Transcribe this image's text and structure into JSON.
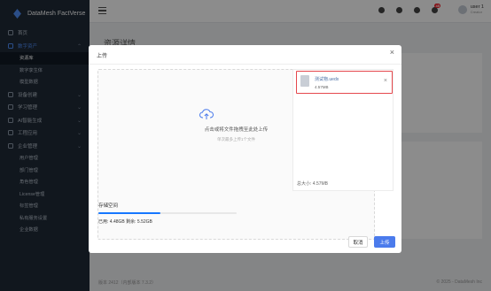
{
  "app": {
    "brand": "DataMesh FactVerse"
  },
  "sidebar": {
    "items": [
      {
        "label": "首页",
        "type": "item"
      },
      {
        "label": "数字资产",
        "type": "group-active"
      },
      {
        "label": "资源库",
        "type": "sub-active"
      },
      {
        "label": "数字孪生体",
        "type": "sub"
      },
      {
        "label": "模型数据",
        "type": "sub"
      },
      {
        "label": "设备创建",
        "type": "group"
      },
      {
        "label": "学习管理",
        "type": "group"
      },
      {
        "label": "AI智能生成",
        "type": "group"
      },
      {
        "label": "工程应用",
        "type": "group"
      },
      {
        "label": "企业管理",
        "type": "group"
      },
      {
        "label": "用户管理",
        "type": "sub"
      },
      {
        "label": "部门管理",
        "type": "sub"
      },
      {
        "label": "角色管理",
        "type": "sub"
      },
      {
        "label": "License管理",
        "type": "sub"
      },
      {
        "label": "标签管理",
        "type": "sub"
      },
      {
        "label": "私有服务设置",
        "type": "sub"
      },
      {
        "label": "企业数据",
        "type": "sub"
      }
    ],
    "version": "版本 2412（内部版本 7.3.2）"
  },
  "topbar": {
    "notification_count": "45",
    "user_name": "user 1",
    "user_role": "Creator"
  },
  "page": {
    "title": "资源详情",
    "footer_copyright": "© 2025 - DataMesh Inc"
  },
  "modal": {
    "title": "上传",
    "close_glyph": "×",
    "drop_text": "点击或将文件拖拽至此处上传",
    "drop_hint": "单次最多上传1个文件",
    "file": {
      "name": "测试物.uedx",
      "size": "4.57MB",
      "remove_glyph": "×"
    },
    "total_size": "总大小: 4.57MB",
    "storage": {
      "label": "存储空间",
      "used_label": "已用: 4.48GB  剩余: 5.52GB",
      "used_fraction": 0.448
    },
    "cancel_label": "取消",
    "upload_label": "上传"
  },
  "colors": {
    "accent": "#4b7bec",
    "sidebar_bg": "#1f2a38",
    "highlight": "#e5484d"
  }
}
